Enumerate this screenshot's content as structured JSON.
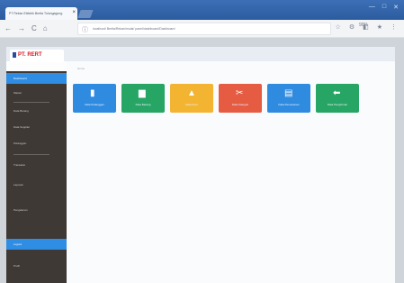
{
  "browser": {
    "tab_title": "PT Rekan Elektrik Berita Tulungagung",
    "tab_close": "×",
    "window_controls": [
      "—",
      "□",
      "✕"
    ],
    "nav_icons": [
      "←",
      "→",
      "C",
      "⌂"
    ],
    "address_text": "localhost/ Berita/Rekan/mulai/ panel/dashboard/Dashboard",
    "zoom_text": "90%",
    "address_end": "☆",
    "extension_icons": [
      "⚙",
      "◧",
      "★",
      "⋮"
    ]
  },
  "app": {
    "logo_text": "PT. RERT",
    "breadcrumb": "Home",
    "sidebar_items": [
      {
        "label": "Dashboard",
        "active": true
      },
      {
        "label": "Master",
        "active": false
      },
      {
        "label": "Data Barang",
        "active": false
      },
      {
        "label": "Data Supplier",
        "active": false
      },
      {
        "label": "Pelanggan",
        "active": false
      },
      {
        "label": "Transaksi",
        "active": false
      },
      {
        "label": "Laporan",
        "active": false
      },
      {
        "label": "Pengaturan",
        "active": false
      },
      {
        "label": "Logout",
        "active": true
      },
      {
        "label": "Profil",
        "active": false
      }
    ],
    "tiles": [
      {
        "label": "Data Pelanggan",
        "icon": "▮",
        "color": "#2f8be0"
      },
      {
        "label": "Data Barang",
        "icon": "▆",
        "color": "#27a564"
      },
      {
        "label": "Data Kurir",
        "icon": "▲",
        "color": "#f2b431"
      },
      {
        "label": "Data Kategori",
        "icon": "✂",
        "color": "#e55c43"
      },
      {
        "label": "Data Pemesanan",
        "icon": "▤",
        "color": "#2f8be0"
      },
      {
        "label": "Data Pengiriman",
        "icon": "⬅",
        "color": "#27a564"
      }
    ]
  }
}
